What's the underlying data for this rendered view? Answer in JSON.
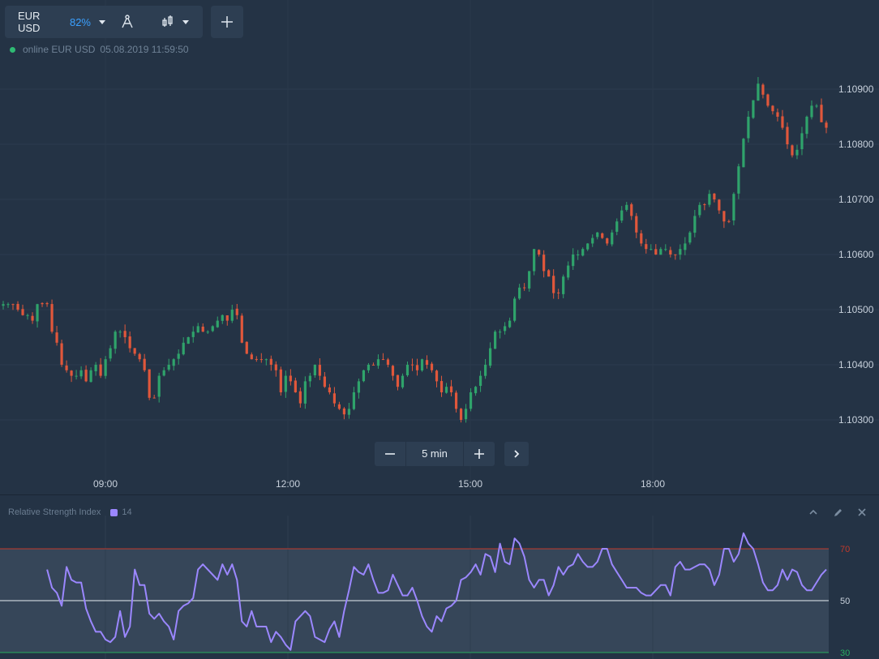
{
  "toolbar": {
    "asset": "EUR USD",
    "payout": "82%",
    "add_label": "+"
  },
  "status": {
    "state": "online",
    "asset": "EUR USD",
    "timestamp": "05.08.2019 11:59:50"
  },
  "zoom": {
    "minus": "−",
    "timeframe": "5 min",
    "plus": "+"
  },
  "icons": {
    "asset_dropdown": "chevron-down-icon",
    "drawing_tools": "compass-icon",
    "chart_type": "candlestick-icon",
    "add_chart": "plus-icon",
    "next": "chevron-right-icon",
    "collapse": "chevron-up-icon",
    "edit": "pencil-icon",
    "close": "close-icon"
  },
  "colors": {
    "background": "#243345",
    "panel": "#2d3e52",
    "up_candle": "#2fa36b",
    "down_candle": "#e0573b",
    "rsi_line": "#9b87ff",
    "rsi_overbought": "#c0392b",
    "rsi_oversold": "#27ae60",
    "payout_accent": "#3aa0ff",
    "online_dot": "#2fbb74"
  },
  "indicator": {
    "name": "Relative Strength Index",
    "period": "14",
    "levels": [
      "70",
      "50",
      "30"
    ]
  },
  "chart_data": {
    "type": "candlestick",
    "price_axis": [
      "1.10900",
      "1.10800",
      "1.10700",
      "1.10600",
      "1.10500",
      "1.10400",
      "1.10300"
    ],
    "time_axis": [
      "09:00",
      "12:00",
      "15:00",
      "18:00"
    ],
    "bar_interval": "5 min",
    "close_series_approx": [
      1.1051,
      1.1051,
      1.1051,
      1.105,
      1.1049,
      1.1049,
      1.1048,
      1.1051,
      1.1051,
      1.1051,
      1.1046,
      1.1044,
      1.104,
      1.1039,
      1.1038,
      1.1038,
      1.1039,
      1.1037,
      1.1039,
      1.104,
      1.1038,
      1.1041,
      1.1043,
      1.1046,
      1.1046,
      1.1045,
      1.1043,
      1.1042,
      1.1041,
      1.1039,
      1.1034,
      1.1034,
      1.1038,
      1.1039,
      1.104,
      1.1041,
      1.1042,
      1.1044,
      1.1045,
      1.1046,
      1.1047,
      1.1046,
      1.1046,
      1.1047,
      1.1048,
      1.1049,
      1.1048,
      1.105,
      1.1049,
      1.1044,
      1.1042,
      1.1041,
      1.1041,
      1.1041,
      1.1041,
      1.104,
      1.1039,
      1.1035,
      1.1038,
      1.1037,
      1.1035,
      1.1033,
      1.1037,
      1.1038,
      1.104,
      1.1038,
      1.1036,
      1.1035,
      1.1033,
      1.1032,
      1.1031,
      1.1032,
      1.1035,
      1.1037,
      1.1039,
      1.104,
      1.104,
      1.1041,
      1.1041,
      1.104,
      1.1038,
      1.1036,
      1.1038,
      1.104,
      1.104,
      1.1039,
      1.1041,
      1.104,
      1.1039,
      1.1037,
      1.1035,
      1.1036,
      1.1035,
      1.1032,
      1.103,
      1.1032,
      1.1035,
      1.1036,
      1.1038,
      1.104,
      1.1043,
      1.1046,
      1.1046,
      1.1047,
      1.1048,
      1.1052,
      1.1054,
      1.1054,
      1.1057,
      1.1061,
      1.106,
      1.1057,
      1.1056,
      1.1053,
      1.1053,
      1.1056,
      1.1058,
      1.106,
      1.106,
      1.1061,
      1.1062,
      1.1063,
      1.1064,
      1.1063,
      1.1062,
      1.1064,
      1.1066,
      1.1068,
      1.1069,
      1.1067,
      1.1064,
      1.1062,
      1.1061,
      1.1061,
      1.106,
      1.1061,
      1.1061,
      1.106,
      1.106,
      1.1061,
      1.1062,
      1.1064,
      1.1067,
      1.1069,
      1.1069,
      1.1071,
      1.107,
      1.1068,
      1.1066,
      1.1066,
      1.1071,
      1.1076,
      1.1081,
      1.1085,
      1.1088,
      1.1091,
      1.1089,
      1.1087,
      1.1086,
      1.1085,
      1.1083,
      1.108,
      1.1078,
      1.1079,
      1.1082,
      1.1085,
      1.1087,
      1.1087,
      1.1084,
      1.1083
    ],
    "rsi_series_approx": [
      null,
      null,
      null,
      null,
      null,
      null,
      null,
      null,
      null,
      62,
      55,
      53,
      48,
      63,
      58,
      57,
      57,
      47,
      42,
      38,
      38,
      35,
      34,
      36,
      46,
      36,
      40,
      62,
      56,
      56,
      45,
      43,
      45,
      42,
      40,
      35,
      46,
      48,
      49,
      51,
      62,
      64,
      62,
      60,
      58,
      64,
      60,
      64,
      58,
      42,
      40,
      46,
      40,
      40,
      40,
      34,
      38,
      36,
      33,
      31,
      42,
      44,
      46,
      44,
      36,
      35,
      34,
      39,
      42,
      36,
      46,
      54,
      63,
      61,
      60,
      64,
      58,
      53,
      53,
      54,
      60,
      56,
      52,
      52,
      55,
      50,
      44,
      40,
      38,
      44,
      42,
      47,
      48,
      50,
      58,
      59,
      61,
      64,
      60,
      68,
      67,
      61,
      72,
      65,
      64,
      74,
      72,
      67,
      58,
      55,
      58,
      58,
      52,
      56,
      63,
      60,
      63,
      64,
      68,
      65,
      63,
      63,
      65,
      70,
      70,
      64,
      61,
      58,
      55,
      55,
      55,
      53,
      52,
      52,
      54,
      56,
      56,
      52,
      63,
      65,
      62,
      62,
      63,
      64,
      64,
      62,
      56,
      60,
      70,
      70,
      65,
      68,
      76,
      72,
      70,
      64,
      57,
      54,
      54,
      56,
      62,
      58,
      62,
      61,
      56,
      54,
      54,
      57,
      60,
      62
    ]
  }
}
